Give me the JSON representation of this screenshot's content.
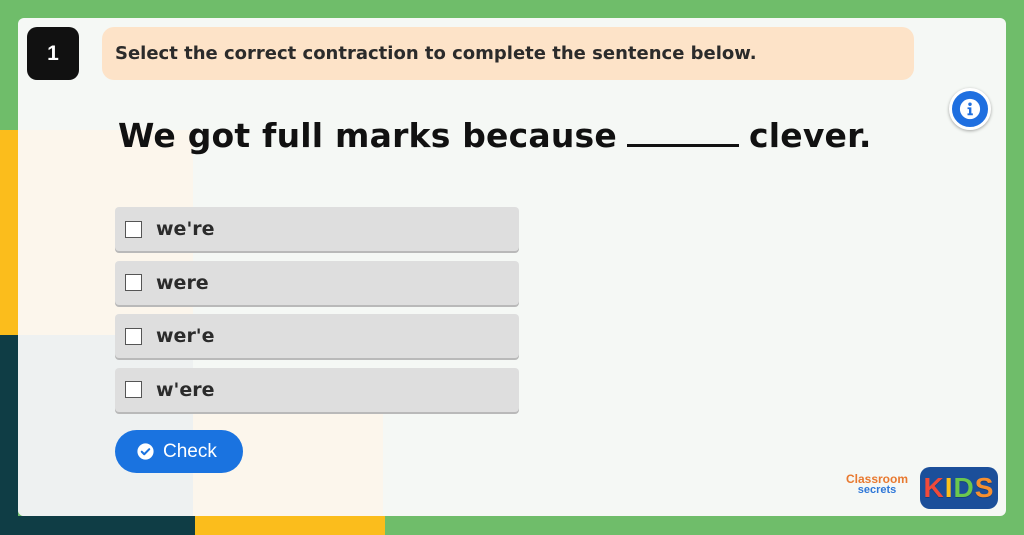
{
  "question": {
    "number": "1",
    "instruction": "Select the correct contraction to complete the sentence below.",
    "sentence_before": "We got full marks because",
    "sentence_after": "clever."
  },
  "options": [
    {
      "label": "we're",
      "checked": false
    },
    {
      "label": "were",
      "checked": false
    },
    {
      "label": "wer'e",
      "checked": false
    },
    {
      "label": "w'ere",
      "checked": false
    }
  ],
  "check_button": {
    "label": "Check"
  },
  "info_button": {
    "icon": "info-icon"
  },
  "logos": {
    "classroom_secrets": {
      "line1": "Classroom",
      "line2": "secrets"
    },
    "kids": {
      "letters": [
        "K",
        "I",
        "D",
        "S"
      ],
      "colors": [
        "#f04a3a",
        "#fbc21b",
        "#6bc84e",
        "#f78f2e"
      ]
    }
  },
  "colors": {
    "background_green": "#6fbd6a",
    "accent_blue": "#1a73e0",
    "instruction_bg": "#fde3c8",
    "option_bg": "#dedede"
  }
}
